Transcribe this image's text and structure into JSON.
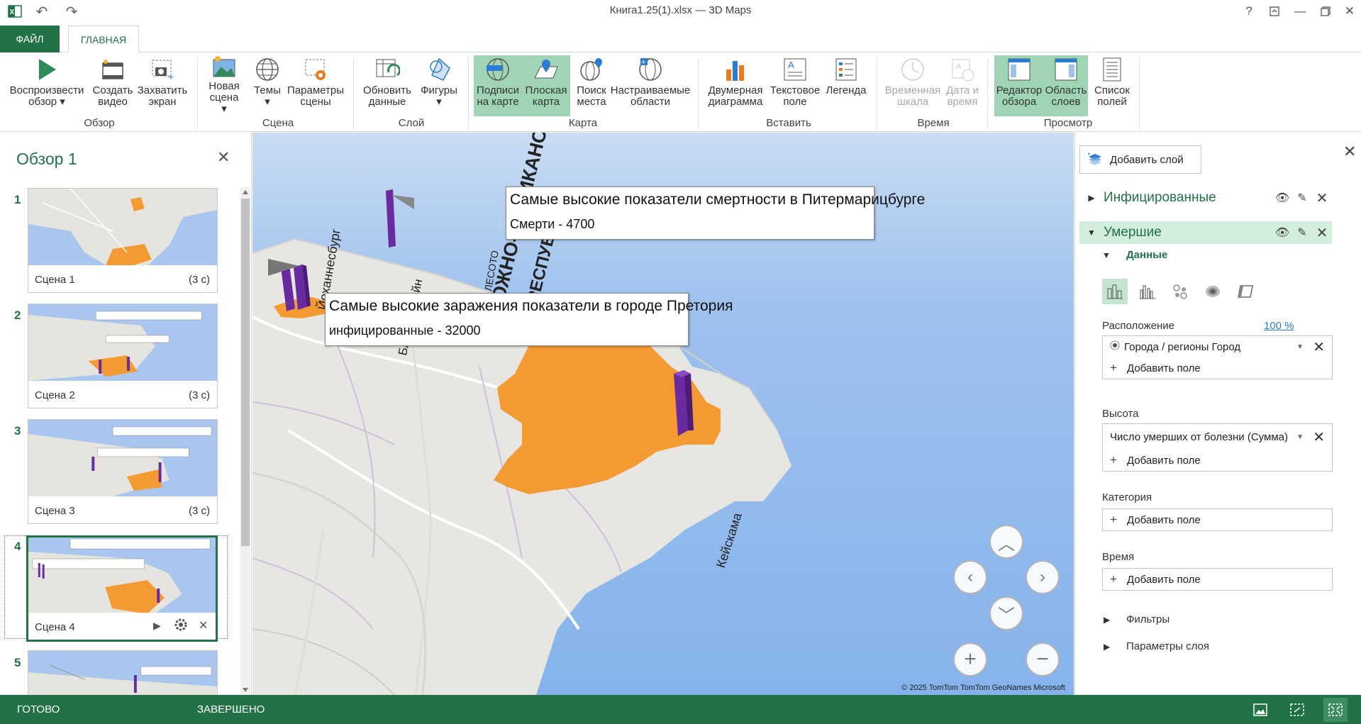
{
  "window": {
    "title": "Книга1.25(1).xlsx — 3D Maps",
    "help": "?"
  },
  "ribbon": {
    "tabs": {
      "file": "ФАЙЛ",
      "home": "ГЛАВНАЯ"
    },
    "groups": {
      "tour": "Обзор",
      "scene": "Сцена",
      "layer": "Слой",
      "map": "Карта",
      "insert": "Вставить",
      "time": "Время",
      "view": "Просмотр"
    },
    "buttons": {
      "play_tour": [
        "Воспроизвести",
        "обзор ▾"
      ],
      "create_video": [
        "Создать",
        "видео"
      ],
      "capture_screen": [
        "Захватить",
        "экран"
      ],
      "new_scene": [
        "Новая",
        "сцена ▾"
      ],
      "themes": [
        "Темы",
        "▾"
      ],
      "scene_options": [
        "Параметры",
        "сцены"
      ],
      "refresh_data": [
        "Обновить",
        "данные"
      ],
      "shapes": [
        "Фигуры",
        "▾"
      ],
      "map_labels": [
        "Подписи",
        "на карте"
      ],
      "flat_map": [
        "Плоская",
        "карта"
      ],
      "find_location": [
        "Поиск",
        "места"
      ],
      "custom_regions": [
        "Настраиваемые",
        "области"
      ],
      "2d_chart": [
        "Двумерная",
        "диаграмма"
      ],
      "text_box": [
        "Текстовое",
        "поле"
      ],
      "legend": [
        "Легенда",
        ""
      ],
      "timeline": [
        "Временная",
        "шкала"
      ],
      "date_time": [
        "Дата и",
        "время"
      ],
      "tour_editor": [
        "Редактор",
        "обзора"
      ],
      "layer_pane": [
        "Область",
        "слоев"
      ],
      "field_list": [
        "Список",
        "полей"
      ]
    }
  },
  "tour": {
    "title": "Обзор 1",
    "scenes": [
      {
        "num": "1",
        "name": "Сцена 1",
        "duration": "(3 с)"
      },
      {
        "num": "2",
        "name": "Сцена 2",
        "duration": "(3 с)"
      },
      {
        "num": "3",
        "name": "Сцена 3",
        "duration": "(3 с)"
      },
      {
        "num": "4",
        "name": "Сцена 4",
        "duration": ""
      },
      {
        "num": "5",
        "name": "",
        "duration": ""
      }
    ]
  },
  "map": {
    "callout_deaths": {
      "title": "Самые высокие показатели смертности в Питермарицбурге",
      "value": "Смерти - 4700"
    },
    "callout_infected": {
      "title": "Самые высокие заражения показатели в городе Претория",
      "value": "инфицированные - 32000"
    },
    "labels": {
      "country": "ЮЖНО-АФРИКАНСКАЯ",
      "country2": "РЕСПУБЛИКА",
      "bloemfontein": "Блумфонтейн",
      "johannesburg": "Йоханнесбург",
      "lesotho": "ЛЕСОТО",
      "keiskamma": "Кейскама"
    },
    "copyright": "© 2025 TomTom   TomTom   GeoNames   Microsoft"
  },
  "layers": {
    "add_layer": "Добавить слой",
    "items": [
      {
        "name": "Инфицированные",
        "expanded": false
      },
      {
        "name": "Умершие",
        "expanded": true
      }
    ],
    "data_section": "Данные",
    "location_label": "Расположение",
    "location_percent": "100 %",
    "location_field": "Города / регионы   Город",
    "add_field": "Добавить поле",
    "height_label": "Высота",
    "height_field": "Число умерших от болезни (Сумма)",
    "category_label": "Категория",
    "time_label": "Время",
    "filters": "Фильтры",
    "layer_options": "Параметры слоя"
  },
  "status": {
    "ready": "ГОТОВО",
    "done": "ЗАВЕРШЕНО"
  },
  "colors": {
    "accent": "#217346",
    "region": "#f39a32",
    "column": "#6a2aa0",
    "water": "#8fb8ec",
    "land": "#e9e9e7"
  }
}
